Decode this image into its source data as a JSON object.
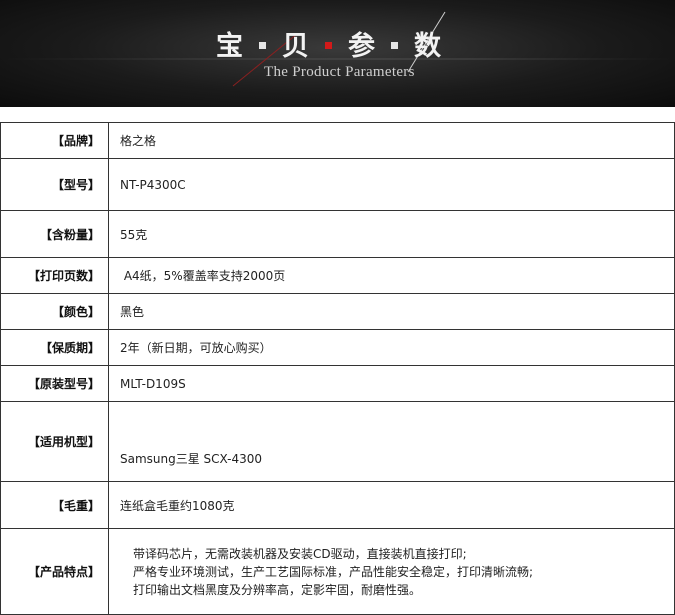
{
  "banner": {
    "title_chars": [
      "宝",
      "贝",
      "参",
      "数"
    ],
    "subtitle": "The Product Parameters",
    "colors": {
      "background": "#151515",
      "accent_dot": "#d21a1a",
      "title": "#f2f2f2"
    }
  },
  "params": [
    {
      "label": "【品牌】",
      "value": "格之格"
    },
    {
      "label": "【型号】",
      "value": "NT-P4300C"
    },
    {
      "label": "【含粉量】",
      "value": "55克"
    },
    {
      "label": "【打印页数】",
      "value": " A4纸，5%覆盖率支持2000页"
    },
    {
      "label": "【颜色】",
      "value": "黑色"
    },
    {
      "label": "【保质期】",
      "value": "2年（新日期，可放心购买）"
    },
    {
      "label": "【原装型号】",
      "value": "MLT-D109S"
    },
    {
      "label": "【适用机型】",
      "value": "Samsung三星 SCX-4300"
    },
    {
      "label": "【毛重】",
      "value": "连纸盒毛重约1080克"
    },
    {
      "label": "【产品特点】",
      "lines": [
        "带译码芯片，无需改装机器及安装CD驱动，直接装机直接打印;",
        "严格专业环境测试，生产工艺国际标准，产品性能安全稳定，打印清晰流畅;",
        "打印输出文档黑度及分辨率高，定影牢固，耐磨性强。"
      ]
    }
  ]
}
